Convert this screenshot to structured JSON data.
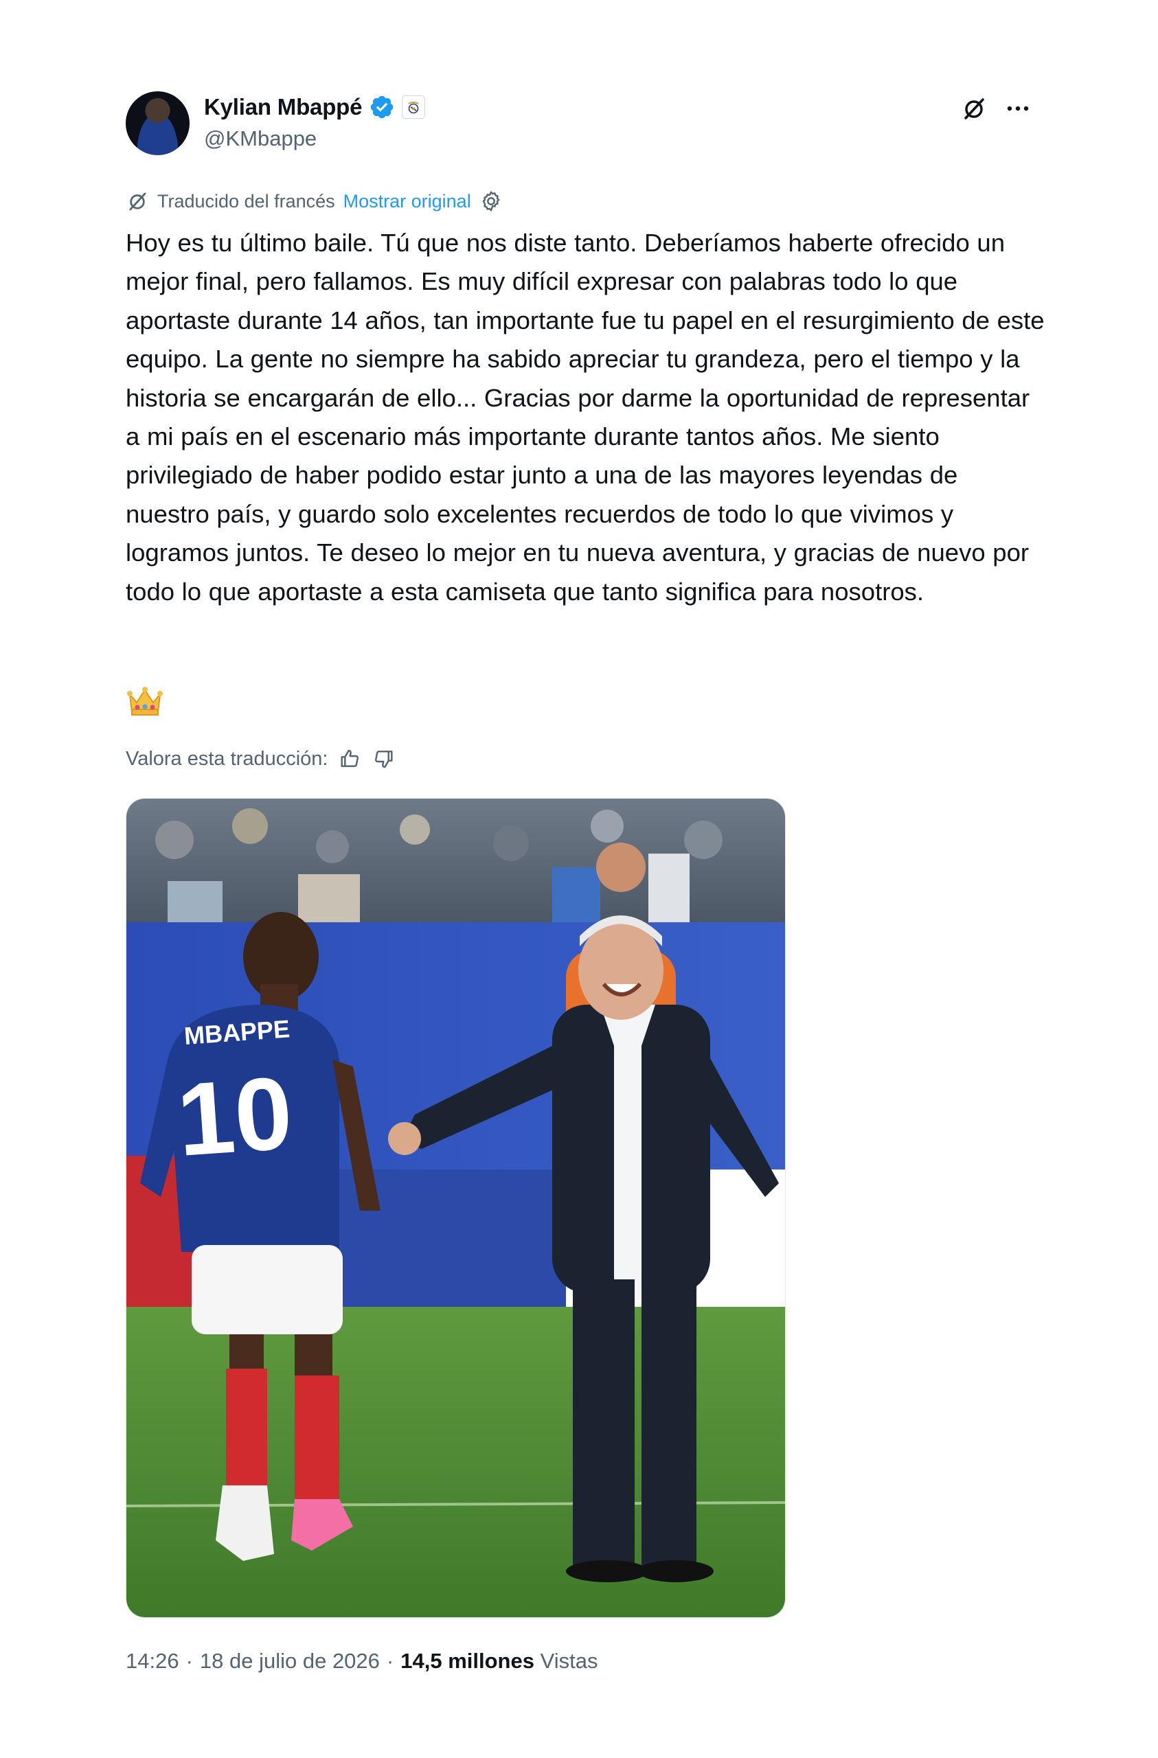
{
  "author": {
    "name": "Kylian Mbappé",
    "handle": "@KMbappe",
    "avatar_icon": "player-avatar",
    "verified_icon": "verified-badge-icon",
    "affiliation_icon": "real-madrid-crest-icon"
  },
  "header_actions": {
    "grok_icon": "grok-icon",
    "more_icon": "more-icon"
  },
  "translation": {
    "label": "Traducido del francés",
    "show_original": "Mostrar original",
    "settings_icon": "gear-icon"
  },
  "tweet": {
    "text": "Hoy es tu último baile. Tú que nos diste tanto. Deberíamos haberte ofrecido un mejor final, pero fallamos. Es muy difícil expresar con palabras todo lo que aportaste durante 14 años, tan importante fue tu papel en el resurgimiento de este equipo. La gente no siempre ha sabido apreciar tu grandeza, pero el tiempo y la historia se encargarán de ello... Gracias por darme la oportunidad de representar a mi país en el escenario más importante durante tantos años. Me siento privilegiado de haber podido estar junto a una de las mayores leyendas de nuestro país, y guardo solo excelentes recuerdos de todo lo que vivimos y logramos juntos. Te deseo lo mejor en tu nueva aventura, y gracias de nuevo por todo lo que aportaste a esta camiseta que tanto significa para nosotros.",
    "emoji": "crown-emoji"
  },
  "rate": {
    "label": "Valora esta traducción:",
    "thumbs_up_icon": "thumbs-up-icon",
    "thumbs_down_icon": "thumbs-down-icon"
  },
  "media": {
    "jersey_name": "MBAPPE",
    "jersey_number": "10"
  },
  "meta": {
    "time": "14:26",
    "sep1": "·",
    "date": "18 de julio de 2026",
    "sep2": "·",
    "views_count": "14,5 millones",
    "views_label": "Vistas"
  },
  "colors": {
    "accent": "#1d9bf0",
    "text": "#0f1419",
    "secondary": "#536471"
  }
}
